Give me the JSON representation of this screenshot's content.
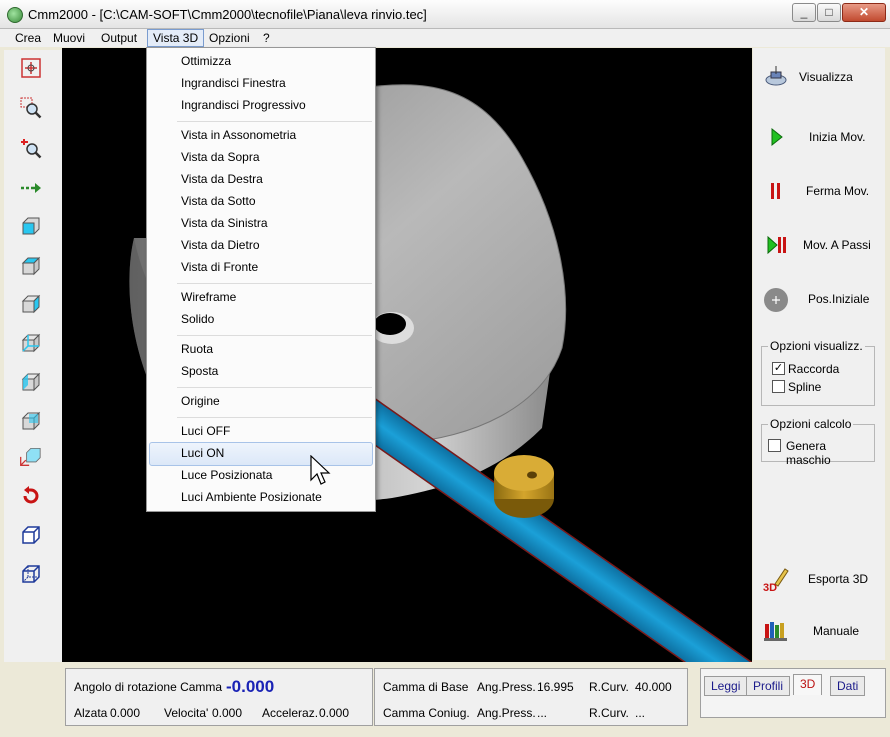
{
  "window": {
    "title": "Cmm2000 - [C:\\CAM-SOFT\\Cmm2000\\tecnofile\\Piana\\leva rinvio.tec]",
    "buttons": [
      "_",
      "□",
      "✕"
    ]
  },
  "menubar": {
    "items": [
      "Crea",
      "Muovi",
      "Output",
      "Vista 3D",
      "Opzioni",
      "?"
    ],
    "active": "Vista 3D"
  },
  "vista3d_menu": {
    "groups": [
      [
        "Ottimizza",
        "Ingrandisci Finestra",
        "Ingrandisci Progressivo"
      ],
      [
        "Vista in Assonometria",
        "Vista da Sopra",
        "Vista da Destra",
        "Vista da Sotto",
        "Vista da Sinistra",
        "Vista da Dietro",
        "Vista di Fronte"
      ],
      [
        "Wireframe",
        "Solido"
      ],
      [
        "Ruota",
        "Sposta"
      ],
      [
        "Origine"
      ],
      [
        "Luci OFF",
        "Luci ON",
        "Luce Posizionata",
        "Luci Ambiente Posizionate"
      ]
    ],
    "highlighted": "Luci ON"
  },
  "left_toolbar": {
    "icons": [
      "center-icon",
      "zoom-window-icon",
      "zoom-progressive-icon",
      "move-arrow-icon",
      "cube-front-icon",
      "cube-top-icon",
      "cube-right-icon",
      "cube-bottom-icon",
      "cube-left-icon",
      "cube-back-icon",
      "cube-axes-icon",
      "rotate-icon",
      "cube-solid-icon",
      "cube-wireframe-icon"
    ]
  },
  "right_panel": {
    "visualizza": "Visualizza",
    "inizia_mov": "Inizia Mov.",
    "ferma_mov": "Ferma Mov.",
    "mov_a_passi": "Mov. A Passi",
    "pos_iniziale": "Pos.Iniziale",
    "opzioni_visualizz": {
      "title": "Opzioni visualizz.",
      "raccorda": "Raccorda",
      "raccorda_checked": true,
      "spline": "Spline",
      "spline_checked": false
    },
    "opzioni_calcolo": {
      "title": "Opzioni calcolo",
      "genera_maschio": "Genera maschio",
      "genera_maschio_checked": false
    },
    "esporta_3d": "Esporta 3D",
    "manuale": "Manuale"
  },
  "status": {
    "angolo_label": "Angolo di rotazione Camma",
    "angolo_value": "-0.000",
    "alzata_label": "Alzata",
    "alzata_value": "0.000",
    "velocita_label": "Velocita'",
    "velocita_value": "0.000",
    "acceleraz_label": "Acceleraz.",
    "acceleraz_value": "0.000",
    "camma_base_label": "Camma di Base",
    "ang_press_label": "Ang.Press.",
    "ang_press_value": "16.995",
    "r_curv_label": "R.Curv.",
    "r_curv_value": "40.000",
    "camma_coniug_label": "Camma Coniug.",
    "ang_press2_label": "Ang.Press.",
    "ang_press2_value": "...",
    "r_curv2_label": "R.Curv.",
    "r_curv2_value": "..."
  },
  "tabs": [
    "Leggi",
    "Profili",
    "3D",
    "Dati"
  ],
  "selected_tab": "3D",
  "colors": {
    "viewport_bg": "#000000",
    "cam_gray": "#a8a8a8",
    "follower_blue": "#1b8fc7",
    "roller_gold": "#c79a25",
    "value_blue": "#1a23b5"
  }
}
